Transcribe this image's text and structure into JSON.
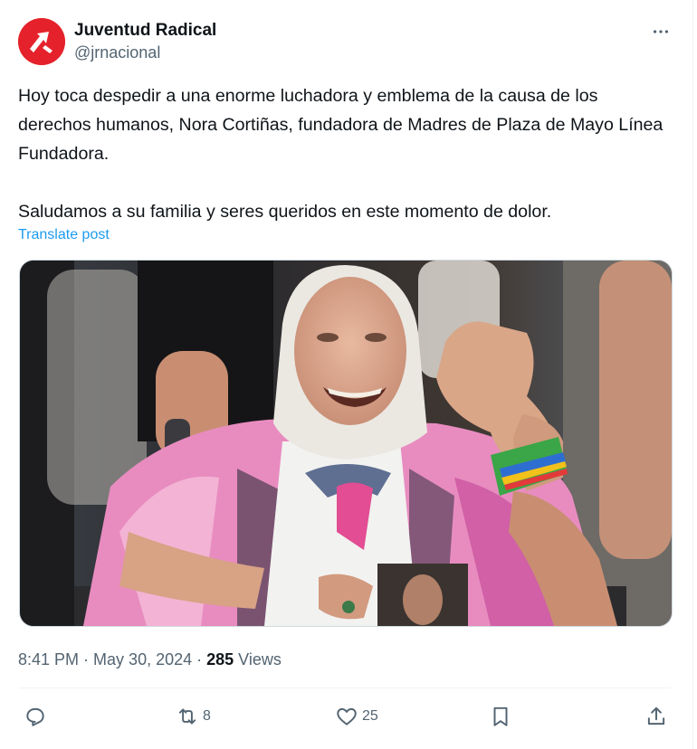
{
  "author": {
    "display_name": "Juventud Radical",
    "handle": "@jrnacional",
    "avatar_color": "#e5222b"
  },
  "tweet": {
    "text": "Hoy toca despedir a una enorme luchadora y emblema de la causa de los derechos humanos, Nora Cortiñas, fundadora de Madres de Plaza de Mayo Línea Fundadora.\n\nSaludamos a su familia y seres queridos en este momento de dolor.",
    "translate_label": "Translate post"
  },
  "meta": {
    "time": "8:41 PM",
    "separator1": " · ",
    "date": "May 30, 2024",
    "separator2": " · ",
    "views_count": "285",
    "views_label": " Views"
  },
  "actions": {
    "reply_icon": "reply-icon",
    "retweet_icon": "retweet-icon",
    "retweet_count": "8",
    "like_icon": "heart-icon",
    "like_count": "25",
    "bookmark_icon": "bookmark-icon",
    "share_icon": "share-icon"
  },
  "colors": {
    "link": "#1d9bf0",
    "muted": "#536471",
    "text": "#0f1419"
  }
}
